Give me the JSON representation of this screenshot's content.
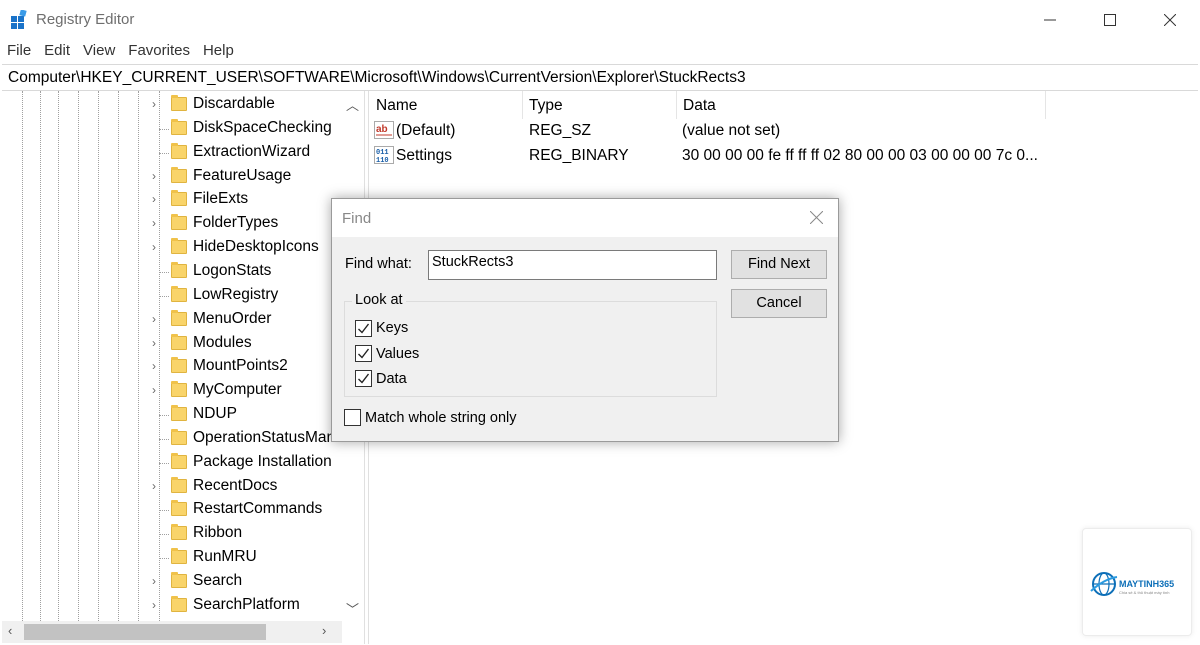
{
  "window": {
    "title": "Registry Editor",
    "minimize": "—",
    "maximize": "☐",
    "close": "✕"
  },
  "menu": [
    "File",
    "Edit",
    "View",
    "Favorites",
    "Help"
  ],
  "address": "Computer\\HKEY_CURRENT_USER\\SOFTWARE\\Microsoft\\Windows\\CurrentVersion\\Explorer\\StuckRects3",
  "tree": {
    "items": [
      {
        "label": "Discardable",
        "expandable": true
      },
      {
        "label": "DiskSpaceChecking",
        "expandable": false
      },
      {
        "label": "ExtractionWizard",
        "expandable": false
      },
      {
        "label": "FeatureUsage",
        "expandable": true
      },
      {
        "label": "FileExts",
        "expandable": true
      },
      {
        "label": "FolderTypes",
        "expandable": true
      },
      {
        "label": "HideDesktopIcons",
        "expandable": true
      },
      {
        "label": "LogonStats",
        "expandable": false
      },
      {
        "label": "LowRegistry",
        "expandable": false
      },
      {
        "label": "MenuOrder",
        "expandable": true
      },
      {
        "label": "Modules",
        "expandable": true
      },
      {
        "label": "MountPoints2",
        "expandable": true
      },
      {
        "label": "MyComputer",
        "expandable": true
      },
      {
        "label": "NDUP",
        "expandable": false
      },
      {
        "label": "OperationStatusMana",
        "expandable": false
      },
      {
        "label": "Package Installation",
        "expandable": false
      },
      {
        "label": "RecentDocs",
        "expandable": true
      },
      {
        "label": "RestartCommands",
        "expandable": false
      },
      {
        "label": "Ribbon",
        "expandable": false
      },
      {
        "label": "RunMRU",
        "expandable": false
      },
      {
        "label": "Search",
        "expandable": true
      },
      {
        "label": "SearchPlatform",
        "expandable": true
      }
    ]
  },
  "values_pane": {
    "columns": [
      "Name",
      "Type",
      "Data"
    ],
    "rows": [
      {
        "icon": "string-value-icon",
        "name": "(Default)",
        "type": "REG_SZ",
        "data": "(value not set)"
      },
      {
        "icon": "binary-value-icon",
        "name": "Settings",
        "type": "REG_BINARY",
        "data": "30 00 00 00 fe ff ff ff 02 80 00 00 03 00 00 00 7c 0..."
      }
    ]
  },
  "find_dialog": {
    "title": "Find",
    "close": "✕",
    "find_what_label": "Find what:",
    "find_what_value": "StuckRects3",
    "find_next_label": "Find Next",
    "cancel_label": "Cancel",
    "look_at_label": "Look at",
    "options": [
      {
        "label": "Keys",
        "checked": true
      },
      {
        "label": "Values",
        "checked": true
      },
      {
        "label": "Data",
        "checked": true
      }
    ],
    "match_whole_label": "Match whole string only",
    "match_whole_checked": false
  },
  "watermark": {
    "brand": "MAYTINH365",
    "tagline": "Chia sẻ & thủ thuật máy tính"
  }
}
